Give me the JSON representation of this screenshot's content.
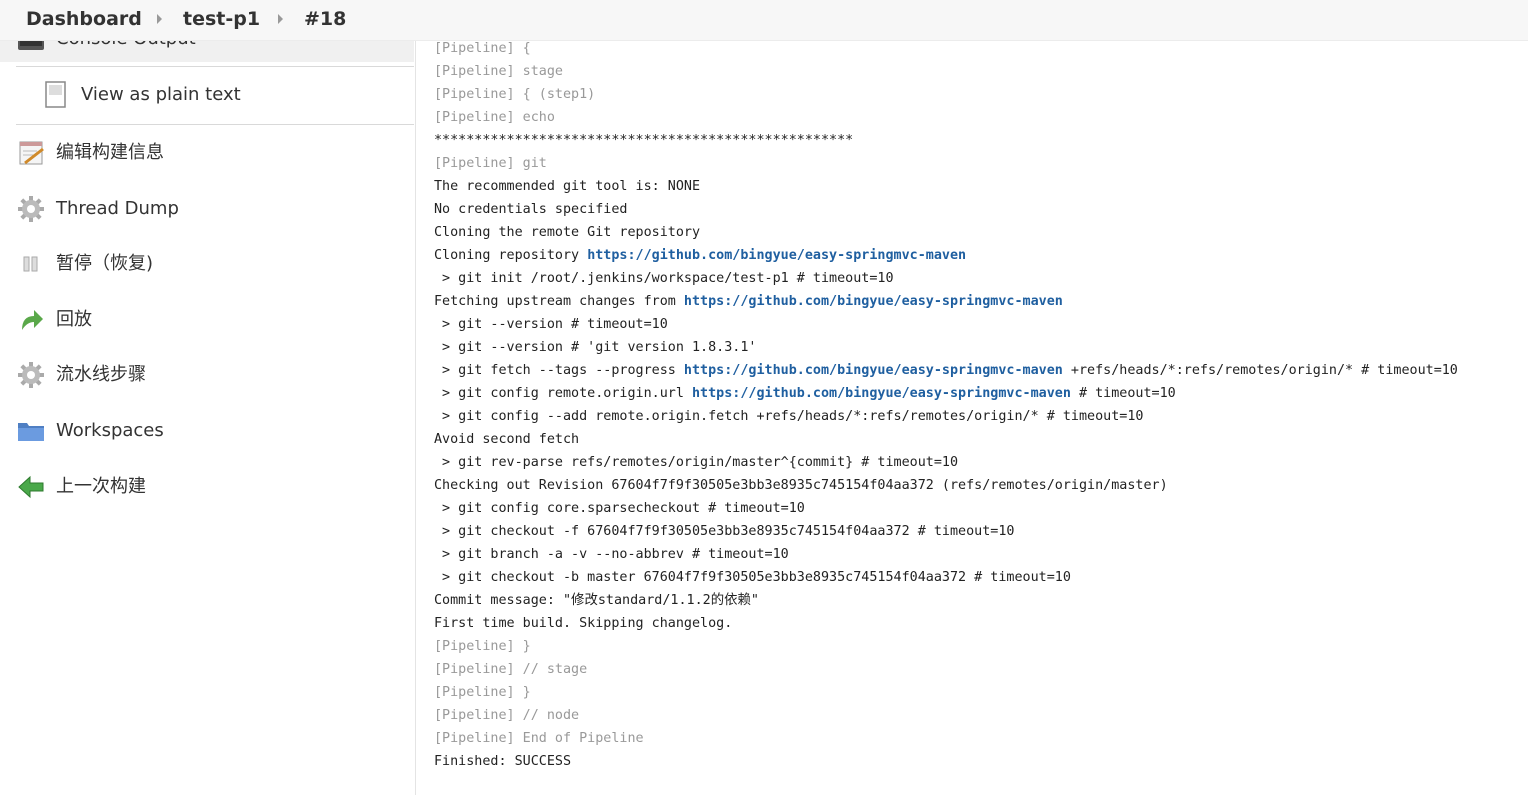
{
  "breadcrumb": {
    "items": [
      "Dashboard",
      "test-p1",
      "#18"
    ]
  },
  "sidebar": {
    "partial_item": "Console Output",
    "sub_item": {
      "label": "View as plain text",
      "icon": "document-icon"
    },
    "items": [
      {
        "label": "编辑构建信息",
        "icon": "notepad-edit-icon"
      },
      {
        "label": "Thread Dump",
        "icon": "gear-icon"
      },
      {
        "label": "暂停（恢复)",
        "icon": "pause-icon"
      },
      {
        "label": "回放",
        "icon": "replay-arrow-icon"
      },
      {
        "label": "流水线步骤",
        "icon": "gear-icon"
      },
      {
        "label": "Workspaces",
        "icon": "folder-icon"
      },
      {
        "label": "上一次构建",
        "icon": "previous-arrow-icon"
      }
    ]
  },
  "console": {
    "lines": [
      {
        "kind": "pipeline",
        "text": "[Pipeline] {"
      },
      {
        "kind": "pipeline",
        "text": "[Pipeline] stage"
      },
      {
        "kind": "pipeline",
        "text": "[Pipeline] { (step1)"
      },
      {
        "kind": "pipeline",
        "text": "[Pipeline] echo"
      },
      {
        "kind": "plain",
        "text": "****************************************************"
      },
      {
        "kind": "pipeline",
        "text": "[Pipeline] git"
      },
      {
        "kind": "plain",
        "text": "The recommended git tool is: NONE"
      },
      {
        "kind": "plain",
        "text": "No credentials specified"
      },
      {
        "kind": "plain",
        "text": "Cloning the remote Git repository"
      },
      {
        "kind": "plain",
        "text": "Cloning repository ",
        "link": "https://github.com/bingyue/easy-springmvc-maven",
        "after": ""
      },
      {
        "kind": "plain",
        "text": " > git init /root/.jenkins/workspace/test-p1 # timeout=10"
      },
      {
        "kind": "plain",
        "text": "Fetching upstream changes from ",
        "link": "https://github.com/bingyue/easy-springmvc-maven",
        "after": ""
      },
      {
        "kind": "plain",
        "text": " > git --version # timeout=10"
      },
      {
        "kind": "plain",
        "text": " > git --version # 'git version 1.8.3.1'"
      },
      {
        "kind": "plain",
        "text": " > git fetch --tags --progress ",
        "link": "https://github.com/bingyue/easy-springmvc-maven",
        "after": " +refs/heads/*:refs/remotes/origin/* # timeout=10"
      },
      {
        "kind": "plain",
        "text": " > git config remote.origin.url ",
        "link": "https://github.com/bingyue/easy-springmvc-maven",
        "after": " # timeout=10"
      },
      {
        "kind": "plain",
        "text": " > git config --add remote.origin.fetch +refs/heads/*:refs/remotes/origin/* # timeout=10"
      },
      {
        "kind": "plain",
        "text": "Avoid second fetch"
      },
      {
        "kind": "plain",
        "text": " > git rev-parse refs/remotes/origin/master^{commit} # timeout=10"
      },
      {
        "kind": "plain",
        "text": "Checking out Revision 67604f7f9f30505e3bb3e8935c745154f04aa372 (refs/remotes/origin/master)"
      },
      {
        "kind": "plain",
        "text": " > git config core.sparsecheckout # timeout=10"
      },
      {
        "kind": "plain",
        "text": " > git checkout -f 67604f7f9f30505e3bb3e8935c745154f04aa372 # timeout=10"
      },
      {
        "kind": "plain",
        "text": " > git branch -a -v --no-abbrev # timeout=10"
      },
      {
        "kind": "plain",
        "text": " > git checkout -b master 67604f7f9f30505e3bb3e8935c745154f04aa372 # timeout=10"
      },
      {
        "kind": "plain",
        "text": "Commit message: \"修改standard/1.1.2的依赖\""
      },
      {
        "kind": "plain",
        "text": "First time build. Skipping changelog."
      },
      {
        "kind": "pipeline",
        "text": "[Pipeline] }"
      },
      {
        "kind": "pipeline",
        "text": "[Pipeline] // stage"
      },
      {
        "kind": "pipeline",
        "text": "[Pipeline] }"
      },
      {
        "kind": "pipeline",
        "text": "[Pipeline] // node"
      },
      {
        "kind": "pipeline",
        "text": "[Pipeline] End of Pipeline"
      },
      {
        "kind": "plain",
        "text": "Finished: SUCCESS"
      }
    ]
  },
  "colors": {
    "link": "#1f5fa0",
    "pipeline_text": "#999999",
    "breadcrumb_bg": "#f7f7f7"
  }
}
